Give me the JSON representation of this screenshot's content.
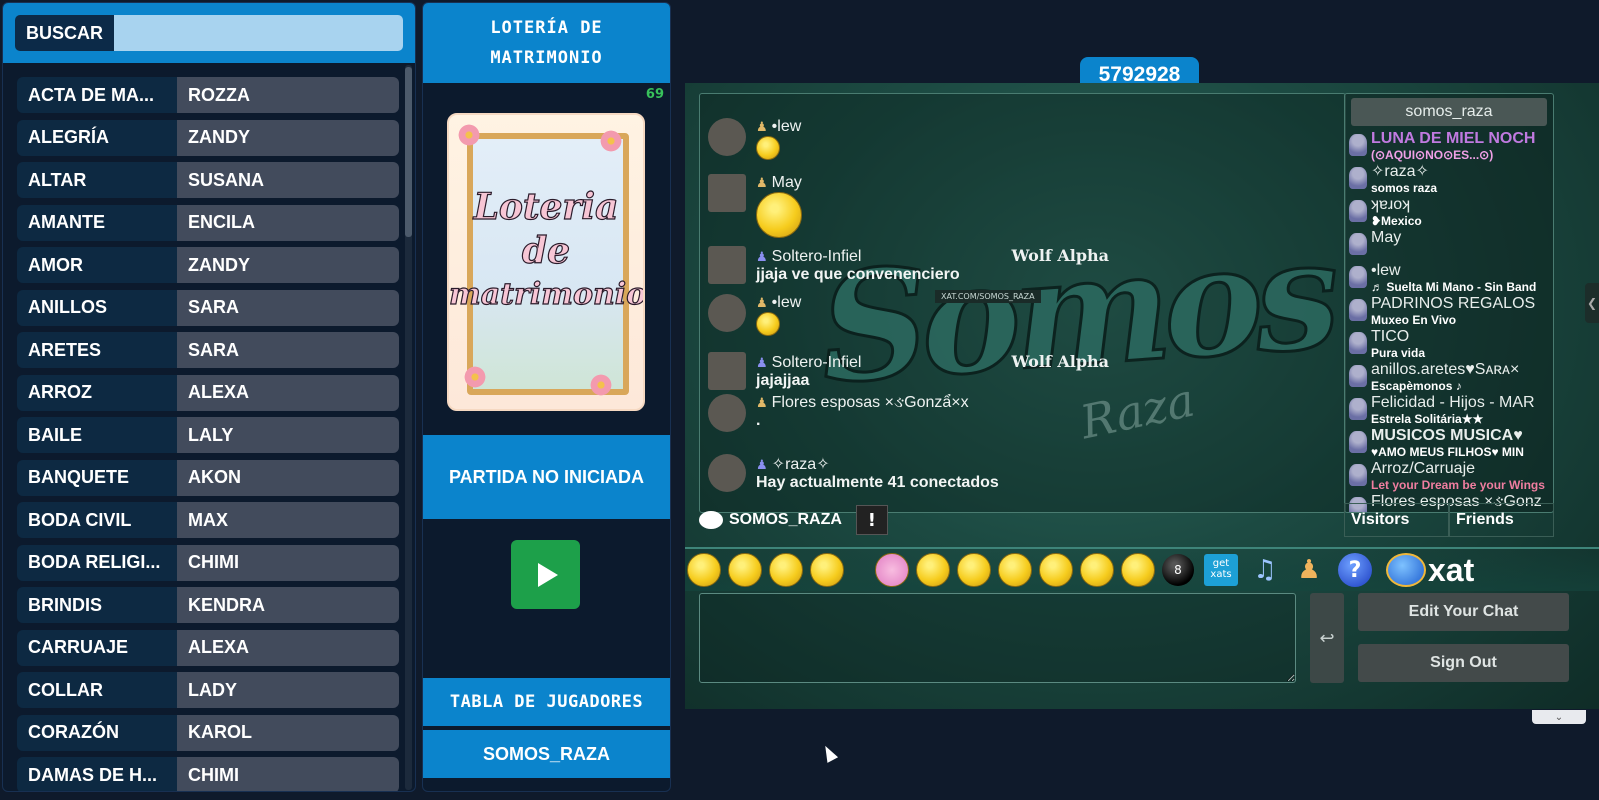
{
  "search": {
    "label": "BUSCAR",
    "value": ""
  },
  "entries": [
    {
      "key": "ACTA DE MA...",
      "value": "ROZZA"
    },
    {
      "key": "ALEGRÍA",
      "value": "ZANDY"
    },
    {
      "key": "ALTAR",
      "value": "SUSANA"
    },
    {
      "key": "AMANTE",
      "value": "ENCILA"
    },
    {
      "key": "AMOR",
      "value": "ZANDY"
    },
    {
      "key": "ANILLOS",
      "value": "SARA"
    },
    {
      "key": "ARETES",
      "value": "SARA"
    },
    {
      "key": "ARROZ",
      "value": "ALEXA"
    },
    {
      "key": "BAILE",
      "value": "LALY"
    },
    {
      "key": "BANQUETE",
      "value": "AKON"
    },
    {
      "key": "BODA CIVIL",
      "value": "MAX"
    },
    {
      "key": "BODA RELIGI...",
      "value": "CHIMI"
    },
    {
      "key": "BRINDIS",
      "value": "KENDRA"
    },
    {
      "key": "CARRUAJE",
      "value": "ALEXA"
    },
    {
      "key": "COLLAR",
      "value": "LADY"
    },
    {
      "key": "CORAZÓN",
      "value": "KAROL"
    },
    {
      "key": "DAMAS DE H...",
      "value": "CHIMI"
    }
  ],
  "game": {
    "title": "LOTERÍA DE MATRIMONIO",
    "count": "69",
    "cover_line1": "Loteria",
    "cover_line2": "de",
    "cover_line3": "matrimonio",
    "status": "PARTIDA NO INICIADA",
    "players_button": "TABLA DE JUGADORES",
    "room_button": "SOMOS_RAZA"
  },
  "chat": {
    "room_id": "5792928",
    "room_name": "SOMOS_RAZA",
    "watermark": "Somos",
    "watermark_sub": "Raza",
    "watermark_tag": "XAT.COM/SOMOS_RAZA",
    "messages": [
      {
        "name": "•lew",
        "text": "",
        "emoji": true
      },
      {
        "name": "May",
        "text": "",
        "emoji": true
      },
      {
        "name": "Soltero-Infiel",
        "text": "jjaja ve que convenenciero",
        "extra": "Wolf Alpha"
      },
      {
        "name": "•lew",
        "text": "",
        "emoji": true
      },
      {
        "name": "Soltero-Infiel",
        "text": "jajajjaa",
        "extra": "Wolf Alpha"
      },
      {
        "name": "Flores esposas ×ઙGonzẩ×x",
        "text": "."
      },
      {
        "name": "✧raza✧",
        "text": "Hay actualmente 41 conectados"
      }
    ],
    "users_header": "somos_raza",
    "users": [
      {
        "name": "LUNA DE MIEL NOCH",
        "status": "(⊙AQUI⊙NO⊙ES...⊙)"
      },
      {
        "name": "✧raza✧",
        "status": "somos raza"
      },
      {
        "name": "ʞɐɹoʞ",
        "status": "❥Mexico"
      },
      {
        "name": "May",
        "status": ""
      },
      {
        "name": "•lew",
        "status": "♬ Suelta Mi Mano - Sin Band"
      },
      {
        "name": "PADRINOS REGALOS",
        "status": "Muxeo En Vivo"
      },
      {
        "name": "TICO",
        "status": "Pura vida"
      },
      {
        "name": "anillos.aretes♥Sᴀʀᴀ×",
        "status": "Escapèmonos ♪"
      },
      {
        "name": "Felicidad - Hijos - MAR",
        "status": "Estrela Solitária★★"
      },
      {
        "name": "MUSICOS MUSICA♥",
        "status": "♥AMO MEUS FILHOS♥ MIN"
      },
      {
        "name": "Arroz/Carruaje",
        "status": "Let your Dream be your Wings"
      },
      {
        "name": "Flores esposas ×ઙGonz",
        "status": ""
      }
    ],
    "tab_visitors": "Visitors",
    "tab_friends": "Friends",
    "warn_symbol": "!",
    "get_xats": "get xats",
    "ball_label": "8",
    "help_symbol": "?",
    "logo": "xat",
    "send_symbol": "↩",
    "edit_button": "Edit Your Chat",
    "signout_button": "Sign Out",
    "side_arrow": "❮",
    "chevron": "⌄"
  }
}
